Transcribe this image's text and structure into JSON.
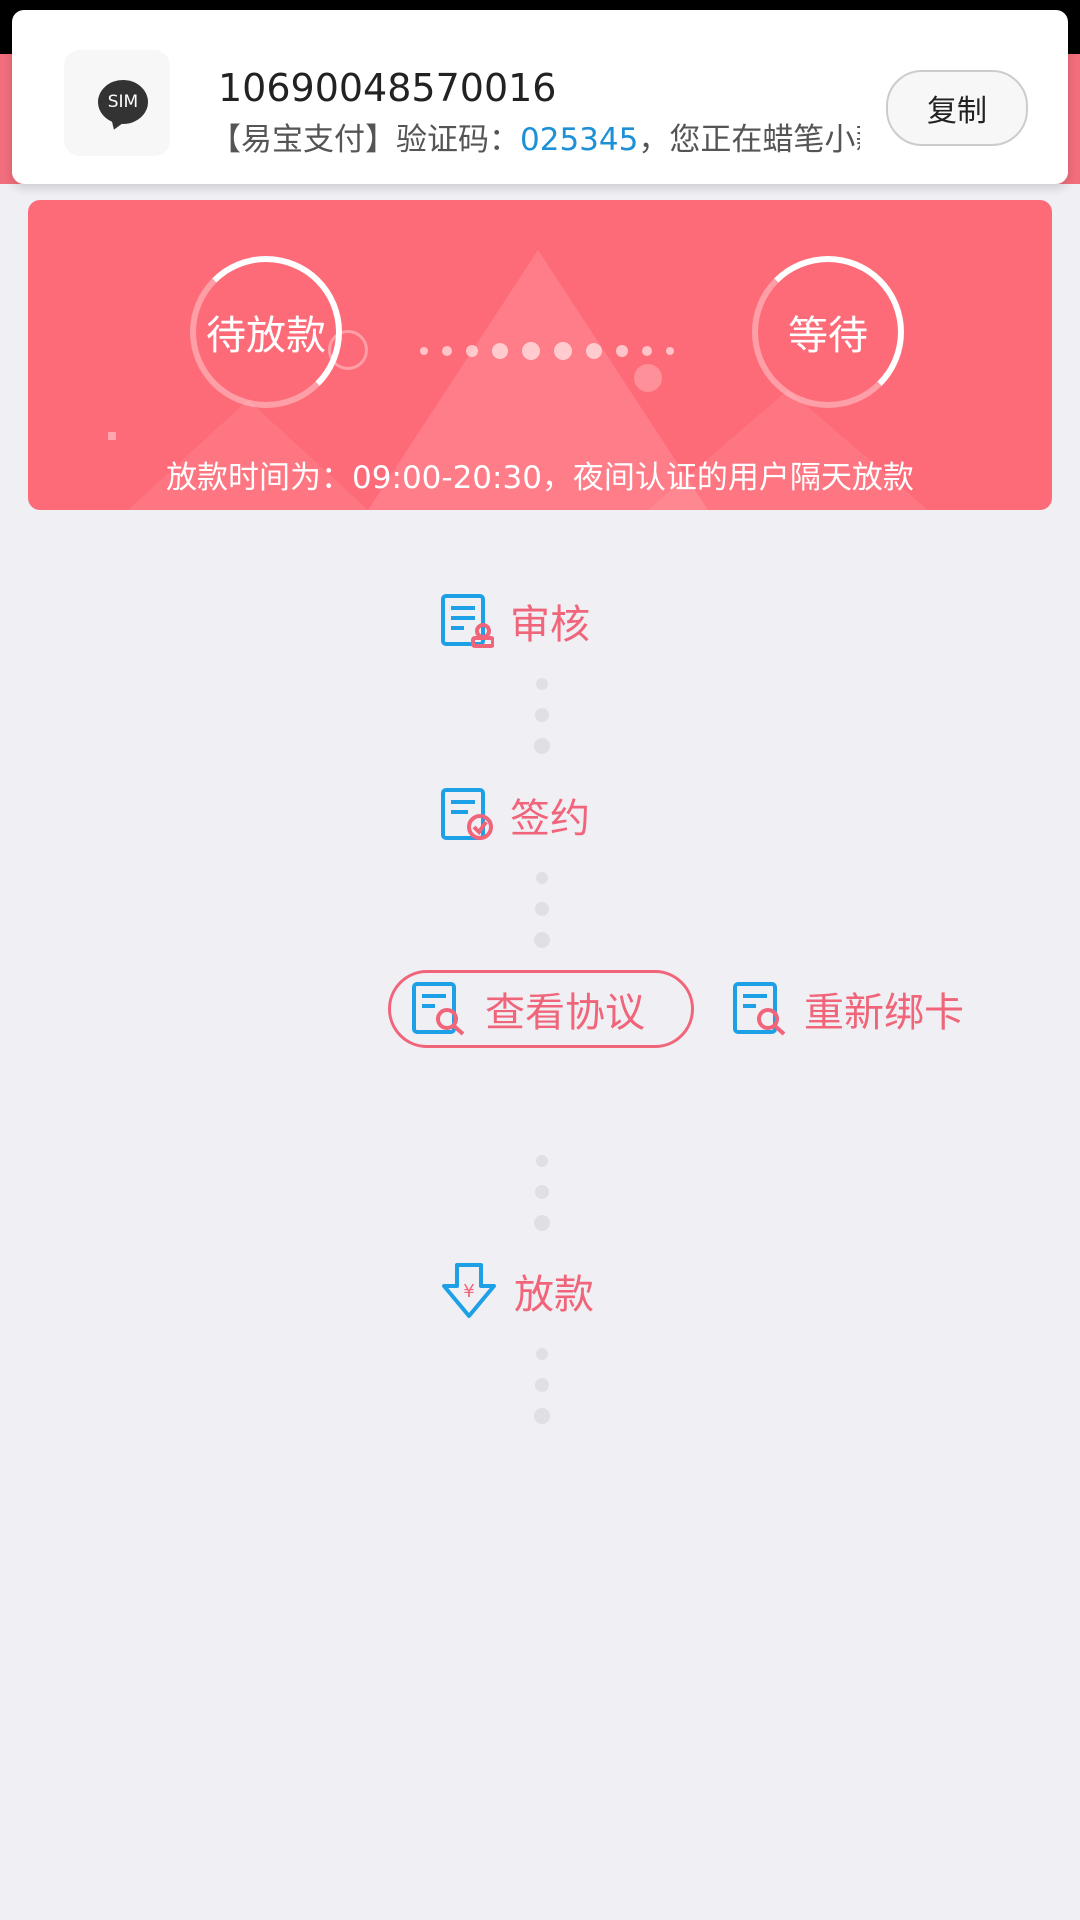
{
  "notification": {
    "app_icon_label": "SIM",
    "sender": "10690048570016",
    "message_prefix": "【易宝支付】验证码：",
    "code": "025345",
    "message_suffix": "，您正在蜡笔小薪…",
    "copy_label": "复制"
  },
  "banner": {
    "left_status": "待放款",
    "right_status": "等待",
    "note": "放款时间为：09:00-20:30，夜间认证的用户隔天放款"
  },
  "steps": {
    "review": "审核",
    "sign": "签约",
    "view_agreement": "查看协议",
    "rebind_card": "重新绑卡",
    "loan": "放款"
  },
  "colors": {
    "accent_red": "#fe6b78",
    "label_pink": "#f0657a",
    "icon_blue": "#1ea0e6",
    "code_blue": "#1e90d6"
  }
}
